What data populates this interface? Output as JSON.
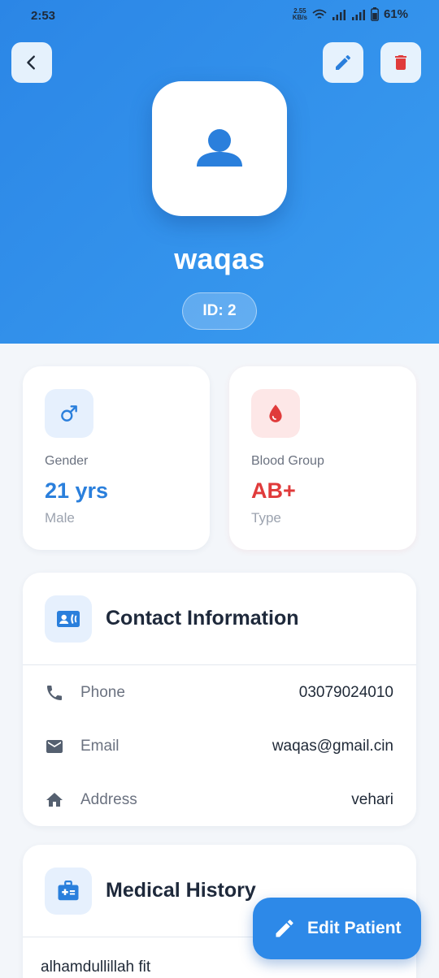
{
  "status_bar": {
    "time": "2:53",
    "net_speed_value": "2.55",
    "net_speed_unit": "KB/s",
    "battery": "61%"
  },
  "header": {
    "back_icon": "chevron-left-icon",
    "edit_icon": "pencil-icon",
    "delete_icon": "trash-icon",
    "avatar_icon": "person-icon",
    "patient_name": "waqas",
    "id_badge": "ID: 2"
  },
  "stats": {
    "gender": {
      "icon": "male-icon",
      "label": "Gender",
      "value": "21 yrs",
      "sub": "Male"
    },
    "blood": {
      "icon": "blood-drop-icon",
      "label": "Blood Group",
      "value": "AB+",
      "sub": "Type"
    }
  },
  "contact": {
    "icon": "contact-card-icon",
    "title": "Contact Information",
    "rows": [
      {
        "icon": "phone-icon",
        "label": "Phone",
        "value": "03079024010"
      },
      {
        "icon": "mail-icon",
        "label": "Email",
        "value": "waqas@gmail.cin"
      },
      {
        "icon": "home-icon",
        "label": "Address",
        "value": "vehari"
      }
    ]
  },
  "medical": {
    "icon": "medical-kit-icon",
    "title": "Medical History",
    "text": "alhamdullillah fit"
  },
  "fab": {
    "icon": "pencil-icon",
    "label": "Edit Patient"
  },
  "colors": {
    "header_gradient_start": "#2b86e6",
    "header_gradient_end": "#3a9cf0",
    "accent_blue": "#2a7fdc",
    "accent_red": "#e03b3b",
    "background": "#f3f6fa"
  }
}
